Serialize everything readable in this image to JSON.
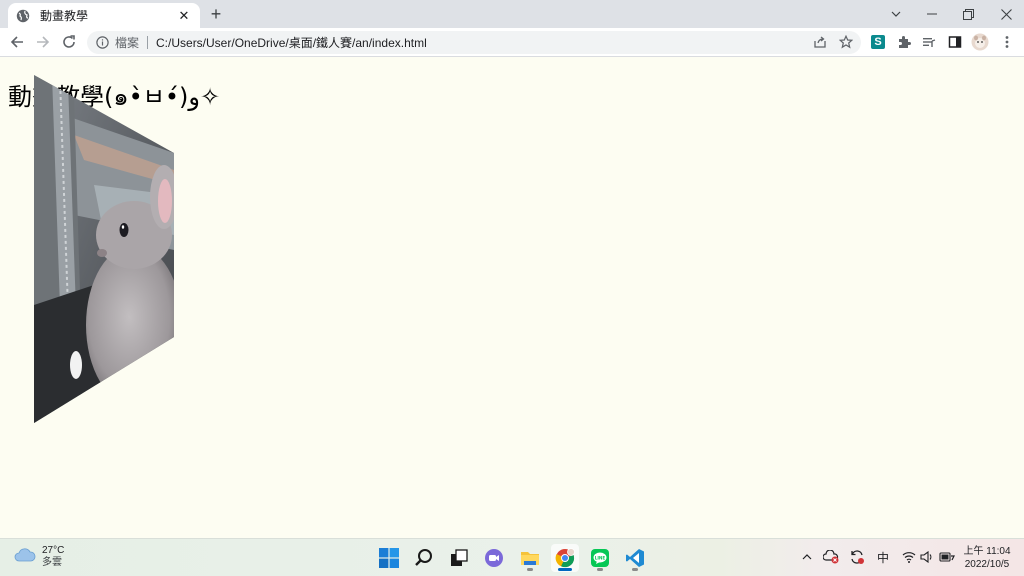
{
  "browser": {
    "tab_title": "動畫教學",
    "address_scheme": "檔案",
    "address_url": "C:/Users/User/OneDrive/桌面/鐵人賽/an/index.html",
    "ext_badge": "S"
  },
  "page": {
    "heading": "動畫教學(๑•̀ㅂ•́)و✧"
  },
  "taskbar": {
    "weather_temp": "27°C",
    "weather_condition": "多雲",
    "ime": "中",
    "time": "上午 11:04",
    "date": "2022/10/5"
  },
  "colors": {
    "page_background": "#fdfdf2",
    "accent": "#0067c0"
  }
}
